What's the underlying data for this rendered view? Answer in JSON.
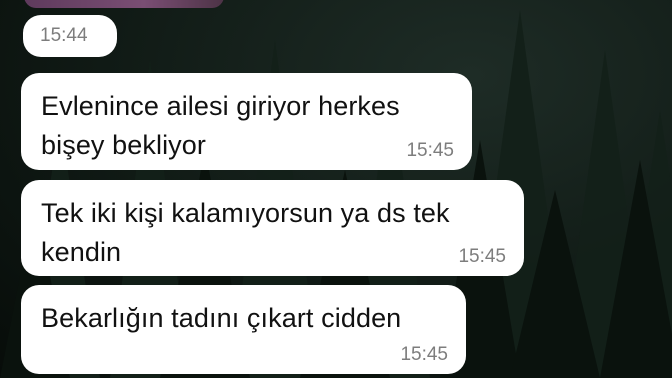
{
  "chat": {
    "previous_media_time": "15:44",
    "messages": [
      {
        "line1": "Evlenince ailesi giriyor herkes",
        "line2": "bişey bekliyor",
        "time": "15:45"
      },
      {
        "line1": "Tek iki kişi kalamıyorsun ya ds tek",
        "line2": "kendin",
        "time": "15:45"
      },
      {
        "line1": "Bekarlığın tadını çıkart cidden",
        "line2": "",
        "time": "15:45"
      }
    ]
  },
  "colors": {
    "bubble": "#ffffff",
    "text": "#111111",
    "time": "#7d7d7d",
    "wallpaper": "#101a15"
  },
  "wallpaper": "dark-pine-forest"
}
